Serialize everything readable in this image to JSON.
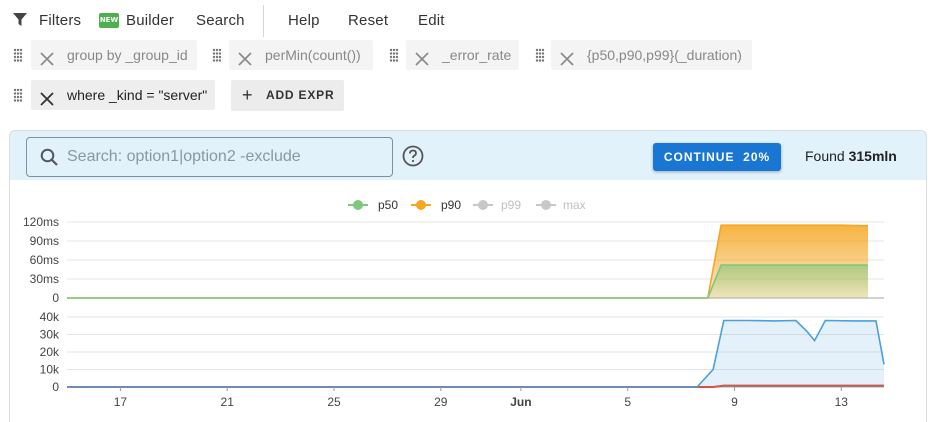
{
  "menu": {
    "filters": "Filters",
    "builder_badge": "NEW",
    "builder": "Builder",
    "search": "Search",
    "help": "Help",
    "reset": "Reset",
    "edit": "Edit"
  },
  "chips": [
    "group by _group_id",
    "perMin(count())",
    "_error_rate",
    "{p50,p90,p99}(_duration)",
    "where _kind = \"server\""
  ],
  "add_expr": "ADD EXPR",
  "search": {
    "placeholder": "Search: option1|option2 -exclude",
    "value": ""
  },
  "continue_label": "CONTINUE",
  "continue_progress": "20%",
  "found_prefix": "Found",
  "found_value": "315mln",
  "colors": {
    "p50": "#7ec87e",
    "p90": "#f5a623",
    "p99": "#c8c8c8",
    "max": "#c8c8c8",
    "count": "#4a9fe0",
    "error": "#e0483c",
    "accent": "#1976d2"
  },
  "chart_data": [
    {
      "type": "area",
      "title": "",
      "legend": [
        "p50",
        "p90",
        "p99",
        "max"
      ],
      "legend_placement": "top-center",
      "legend_disabled": [
        "p99",
        "max"
      ],
      "y_ticks": [
        "120ms",
        "90ms",
        "60ms",
        "30ms",
        "0"
      ],
      "ylim": [
        0,
        120
      ],
      "x_ticks": [
        "17",
        "21",
        "25",
        "29",
        "Jun",
        "5",
        "9",
        "13"
      ],
      "series": [
        {
          "name": "p50",
          "x": [
            "May 15",
            "May 16",
            "May 17",
            "May 18",
            "May 19",
            "May 20",
            "May 21",
            "May 22",
            "May 23",
            "May 24",
            "May 25",
            "May 26",
            "May 27",
            "May 28",
            "May 29",
            "May 30",
            "May 31",
            "Jun 1",
            "Jun 2",
            "Jun 3",
            "Jun 4",
            "Jun 5",
            "Jun 6",
            "Jun 7",
            "Jun 8",
            "Jun 8.5",
            "Jun 9",
            "Jun 10",
            "Jun 11",
            "Jun 12",
            "Jun 13",
            "Jun 14"
          ],
          "values": [
            0,
            0,
            0,
            0,
            0,
            0,
            0,
            0,
            0,
            0,
            0,
            0,
            0,
            0,
            0,
            0,
            0,
            0,
            0,
            0,
            0,
            0,
            0,
            0,
            0,
            52,
            52,
            52,
            52,
            52,
            52,
            52
          ]
        },
        {
          "name": "p90",
          "x": [
            "May 15",
            "May 16",
            "May 17",
            "May 18",
            "May 19",
            "May 20",
            "May 21",
            "May 22",
            "May 23",
            "May 24",
            "May 25",
            "May 26",
            "May 27",
            "May 28",
            "May 29",
            "May 30",
            "May 31",
            "Jun 1",
            "Jun 2",
            "Jun 3",
            "Jun 4",
            "Jun 5",
            "Jun 6",
            "Jun 7",
            "Jun 8",
            "Jun 8.5",
            "Jun 9",
            "Jun 10",
            "Jun 11",
            "Jun 12",
            "Jun 13",
            "Jun 14"
          ],
          "values": [
            0,
            0,
            0,
            0,
            0,
            0,
            0,
            0,
            0,
            0,
            0,
            0,
            0,
            0,
            0,
            0,
            0,
            0,
            0,
            0,
            0,
            0,
            0,
            0,
            0,
            115,
            115,
            115,
            115,
            115,
            115,
            114
          ]
        }
      ]
    },
    {
      "type": "area",
      "title": "",
      "y_ticks": [
        "40k",
        "30k",
        "20k",
        "10k",
        "0"
      ],
      "ylim": [
        0,
        40000
      ],
      "x_ticks": [
        "17",
        "21",
        "25",
        "29",
        "Jun",
        "5",
        "9",
        "13"
      ],
      "series": [
        {
          "name": "count",
          "x": [
            "May 15",
            "Jun 7.6",
            "Jun 8.2",
            "Jun 8.6",
            "Jun 9.5",
            "Jun 10.5",
            "Jun 11.3",
            "Jun 11.7",
            "Jun 12",
            "Jun 12.4",
            "Jun 13.5",
            "Jun 14.3",
            "Jun 14.6"
          ],
          "values": [
            0,
            0,
            10000,
            38000,
            38000,
            37800,
            38000,
            32000,
            26500,
            38000,
            37800,
            37800,
            13000
          ]
        },
        {
          "name": "_error_rate",
          "x": [
            "May 15",
            "Jun 8.2",
            "Jun 8.6",
            "Jun 14.6"
          ],
          "values": [
            0,
            0,
            800,
            800
          ]
        }
      ]
    }
  ]
}
